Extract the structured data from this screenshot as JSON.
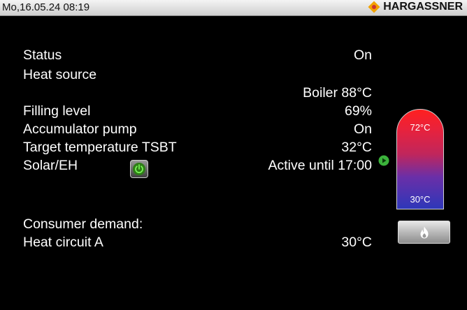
{
  "header": {
    "datetime": "Mo,16.05.24 08:19",
    "brand": "HARGASSNER",
    "logo_icon": "hargassner-logo-icon"
  },
  "rows": [
    {
      "label": "Status",
      "value": "On"
    },
    {
      "label": "Heat source",
      "value": ""
    },
    {
      "label": "",
      "value": "Boiler 88°C"
    },
    {
      "label": "Filling level",
      "value": "69%"
    },
    {
      "label": "Accumulator pump",
      "value": "On"
    },
    {
      "label": "Target temperature TSBT",
      "value": "32°C"
    },
    {
      "label": "Solar/EH",
      "value": "Active until 17:00"
    },
    {
      "label": "Consumer demand:",
      "value": ""
    },
    {
      "label": "Heat circuit A",
      "value": "30°C"
    }
  ],
  "icons": {
    "solar_button": "power-icon",
    "active_indicator": "play-icon",
    "flame_button": "flame-icon"
  },
  "tank": {
    "top_temp": "72°C",
    "bottom_temp": "30°C",
    "colors": {
      "hot": "#ff1f1f",
      "cold": "#2e37b9"
    }
  }
}
